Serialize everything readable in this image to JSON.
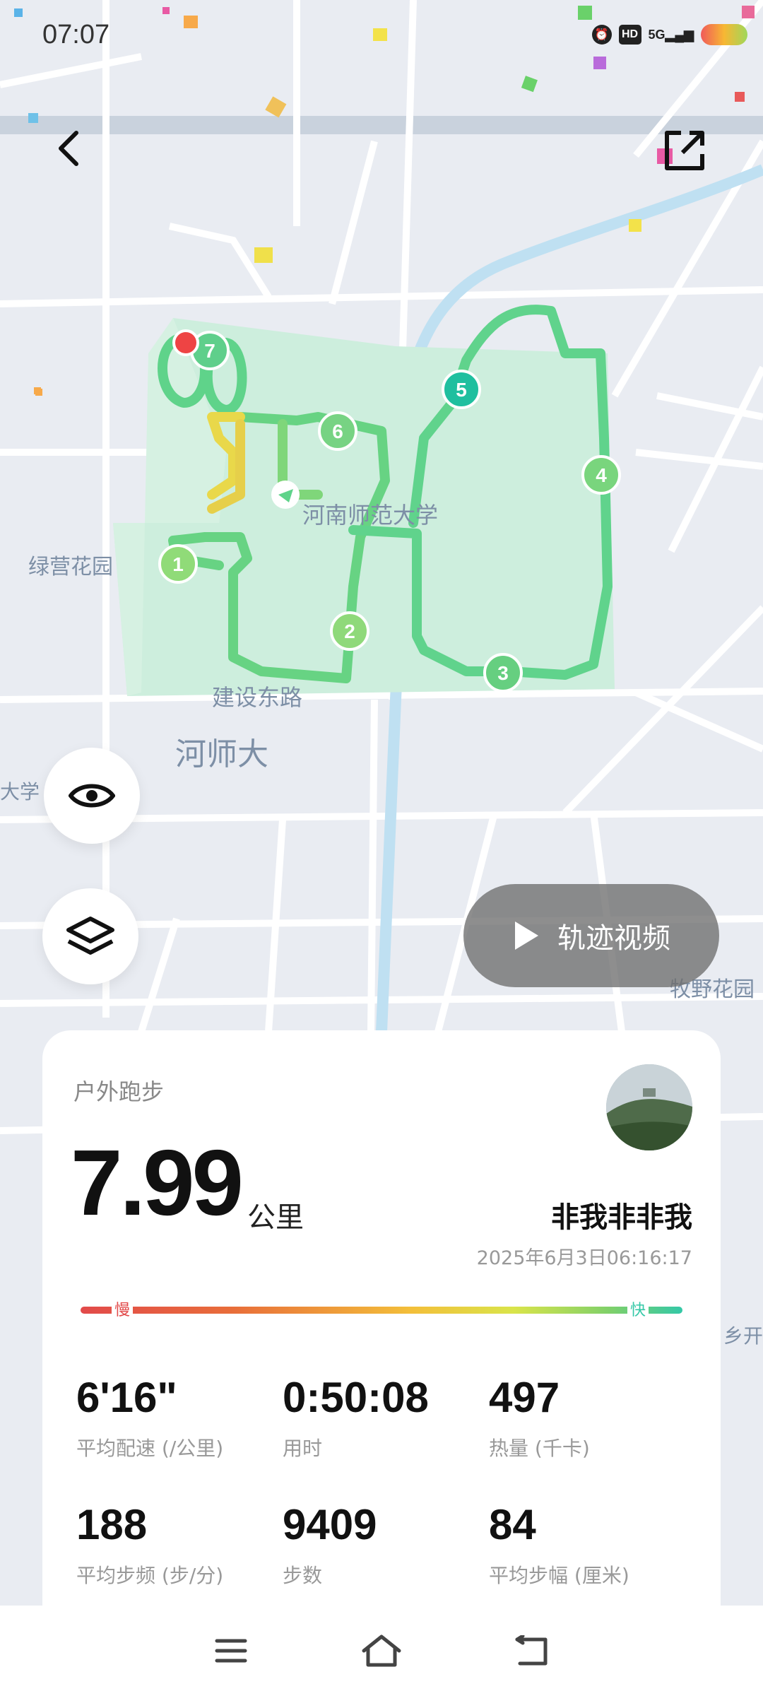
{
  "status_bar": {
    "time": "07:07",
    "icons": [
      "alarm-icon",
      "hd-icon",
      "5g-signal-icon",
      "battery-icon"
    ],
    "hd": "HD",
    "network": "5G"
  },
  "map": {
    "labels": {
      "campus": "河南师范大学",
      "road": "建设东路",
      "district": "河师大",
      "garden_west": "绿营花园",
      "garden_east": "牧野花园",
      "edge_left": "大学",
      "edge_right": "乡开"
    },
    "km_markers": [
      "1",
      "2",
      "3",
      "4",
      "5",
      "6",
      "7"
    ]
  },
  "controls": {
    "back": "back-arrow-icon",
    "share": "share-icon",
    "eye": "eye-icon",
    "layers": "layers-icon",
    "video_label": "轨迹视频"
  },
  "summary": {
    "activity_type": "户外跑步",
    "distance": "7.99",
    "distance_unit": "公里",
    "username": "非我非非我",
    "datetime": "2025年6月3日06:16:17",
    "scale_slow": "慢",
    "scale_fast": "快",
    "stats": [
      {
        "value": "6'16\"",
        "label": "平均配速 (/公里)"
      },
      {
        "value": "0:50:08",
        "label": "用时"
      },
      {
        "value": "497",
        "label": "热量 (千卡)"
      },
      {
        "value": "188",
        "label": "平均步频 (步/分)"
      },
      {
        "value": "9409",
        "label": "步数"
      },
      {
        "value": "84",
        "label": "平均步幅 (厘米)"
      }
    ]
  },
  "colors": {
    "route_fast": "#5fd38a",
    "route_slow": "#f0d24a",
    "marker": "#69d07e",
    "marker_current": "#1fbf9f",
    "start_pin": "#ee4444",
    "campus": "#cdeedd"
  },
  "nav": [
    "menu-icon",
    "home-icon",
    "back-icon"
  ]
}
